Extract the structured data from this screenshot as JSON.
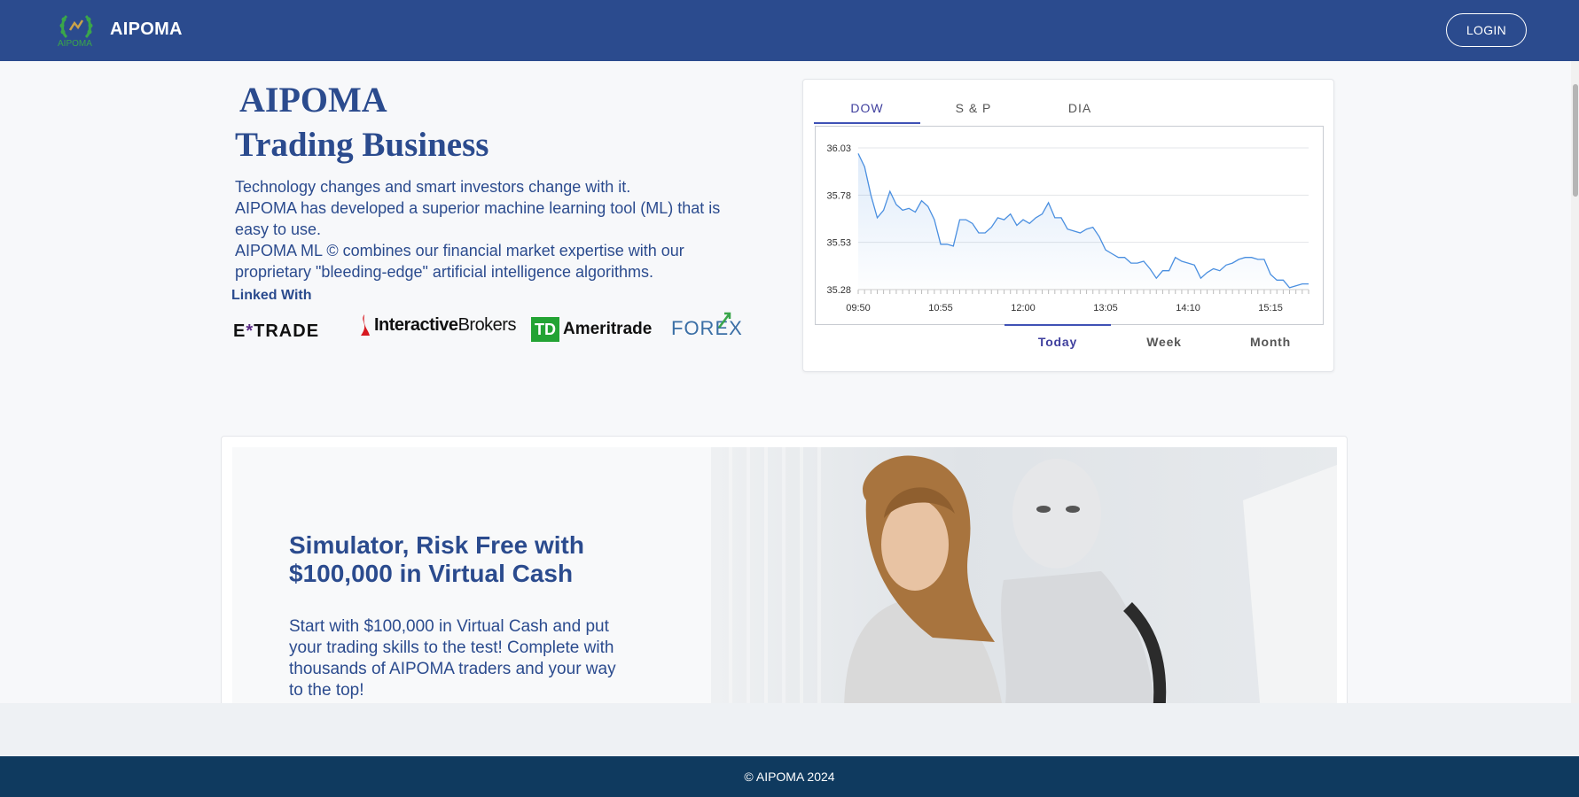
{
  "header": {
    "brand": "AIPOMA",
    "logo_text": "AIPOMA",
    "login_label": "LOGIN"
  },
  "hero": {
    "title_line1": "AIPOMA",
    "title_line2": "Trading Business",
    "paragraph": [
      "Technology changes and smart investors change with it.",
      "AIPOMA has developed a superior machine learning tool (ML) that is easy to use.",
      "AIPOMA ML © combines our financial market expertise with our proprietary \"bleeding-edge\" artificial intelligence algorithms."
    ],
    "linked_with": "Linked With",
    "partners": {
      "etrade_left": "E",
      "etrade_x": "*",
      "etrade_right": "TRADE",
      "ib_bold": "Interactive",
      "ib_rest": "Brokers",
      "td_box": "TD",
      "td_text": "Ameritrade",
      "forex": "FOREX"
    }
  },
  "chart_widget": {
    "tabs": [
      "DOW",
      "S & P",
      "DIA"
    ],
    "active_tab": "DOW",
    "periods": [
      "Today",
      "Week",
      "Month"
    ],
    "active_period": "Today"
  },
  "chart_data": {
    "type": "area",
    "title": "",
    "xlabel": "",
    "ylabel": "",
    "x_ticks": [
      "09:50",
      "10:55",
      "12:00",
      "13:05",
      "14:10",
      "15:15"
    ],
    "y_ticks": [
      "36.03",
      "35.78",
      "35.53",
      "35.28"
    ],
    "ylim": [
      35.28,
      36.03
    ],
    "x_range": [
      "09:50",
      "15:45"
    ],
    "grid": true,
    "color": "#4a8fe0",
    "x": [
      "09:50",
      "09:55",
      "10:00",
      "10:05",
      "10:10",
      "10:15",
      "10:20",
      "10:25",
      "10:30",
      "10:35",
      "10:40",
      "10:45",
      "10:50",
      "10:55",
      "11:00",
      "11:05",
      "11:10",
      "11:15",
      "11:20",
      "11:25",
      "11:30",
      "11:35",
      "11:40",
      "11:45",
      "11:50",
      "11:55",
      "12:00",
      "12:05",
      "12:10",
      "12:15",
      "12:20",
      "12:25",
      "12:30",
      "12:35",
      "12:40",
      "12:45",
      "12:50",
      "12:55",
      "13:00",
      "13:05",
      "13:10",
      "13:15",
      "13:20",
      "13:25",
      "13:30",
      "13:35",
      "13:40",
      "13:45",
      "13:50",
      "13:55",
      "14:00",
      "14:05",
      "14:10",
      "14:15",
      "14:20",
      "14:25",
      "14:30",
      "14:35",
      "14:40",
      "14:45",
      "14:50",
      "14:55",
      "15:00",
      "15:05",
      "15:10",
      "15:15",
      "15:20",
      "15:25",
      "15:30",
      "15:35",
      "15:40",
      "15:45"
    ],
    "values": [
      36.0,
      35.93,
      35.78,
      35.66,
      35.7,
      35.8,
      35.73,
      35.7,
      35.71,
      35.69,
      35.75,
      35.72,
      35.65,
      35.52,
      35.52,
      35.51,
      35.65,
      35.65,
      35.63,
      35.58,
      35.58,
      35.61,
      35.66,
      35.65,
      35.68,
      35.62,
      35.65,
      35.63,
      35.66,
      35.68,
      35.74,
      35.66,
      35.66,
      35.6,
      35.59,
      35.58,
      35.6,
      35.61,
      35.56,
      35.49,
      35.47,
      35.45,
      35.45,
      35.42,
      35.42,
      35.43,
      35.39,
      35.34,
      35.38,
      35.38,
      35.45,
      35.43,
      35.42,
      35.41,
      35.34,
      35.37,
      35.39,
      35.38,
      35.41,
      35.42,
      35.44,
      35.45,
      35.45,
      35.44,
      35.44,
      35.36,
      35.33,
      35.33,
      35.29,
      35.3,
      35.31,
      35.31
    ]
  },
  "promo": {
    "title": "Simulator, Risk Free with $100,000 in Virtual Cash",
    "text": "Start with $100,000 in Virtual Cash and put your trading skills to the test! Complete with thousands of AIPOMA traders and your way to the top!"
  },
  "footer": {
    "copyright": "© AIPOMA 2024"
  }
}
